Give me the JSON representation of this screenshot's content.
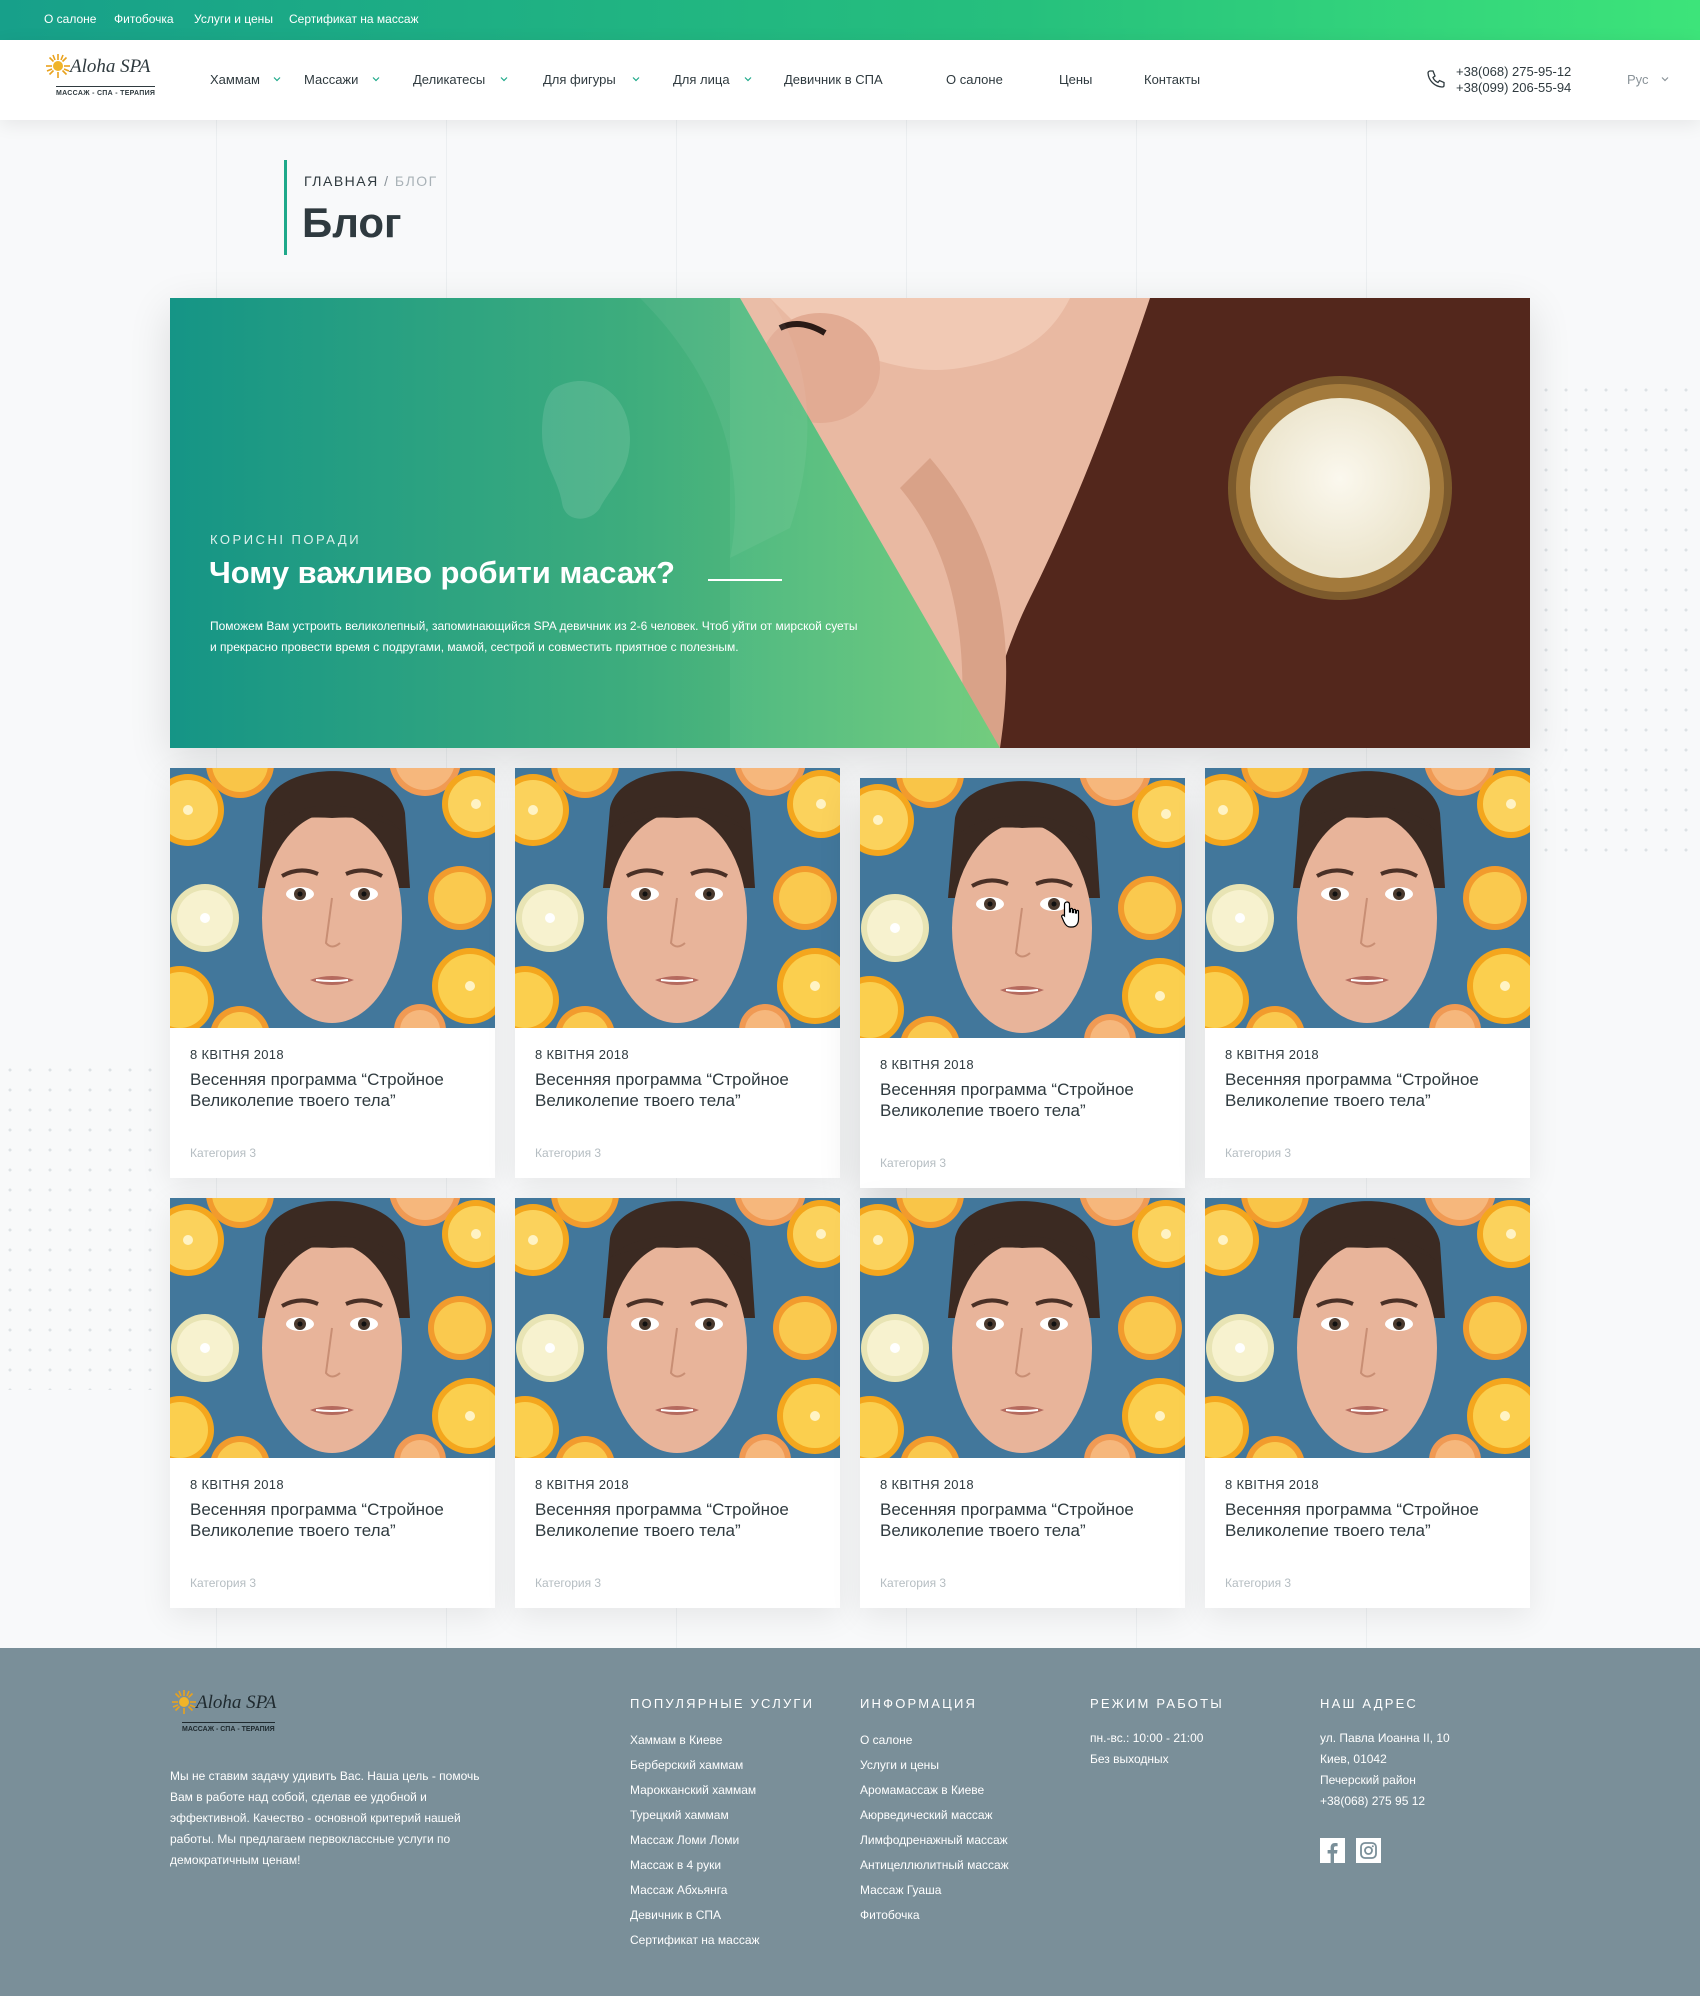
{
  "topbar": {
    "links": [
      "О салоне",
      "Фитобочка",
      "Услуги и цены",
      "Сертификат на массаж"
    ]
  },
  "brand": {
    "name": "Aloha SPA",
    "tagline": "МАССАЖ - СПА - ТЕРАПИЯ"
  },
  "nav": {
    "items": [
      {
        "label": "Хаммам",
        "dropdown": true
      },
      {
        "label": "Массажи",
        "dropdown": true
      },
      {
        "label": "Деликатесы",
        "dropdown": true
      },
      {
        "label": "Для фигуры",
        "dropdown": true
      },
      {
        "label": "Для лица",
        "dropdown": true
      },
      {
        "label": "Девичник в СПА",
        "dropdown": false
      },
      {
        "label": "О салоне",
        "dropdown": false
      },
      {
        "label": "Цены",
        "dropdown": false
      },
      {
        "label": "Контакты",
        "dropdown": false
      }
    ],
    "phone_1": "+38(068) 275-95-12",
    "phone_2": "+38(099) 206-55-94",
    "language": "Рус"
  },
  "breadcrumb": {
    "home": "ГЛАВНАЯ",
    "separator": " / ",
    "current": "БЛОГ"
  },
  "page": {
    "title": "Блог"
  },
  "hero": {
    "label": "КОРИСНІ ПОРАДИ",
    "title": "Чому важливо робити масаж?",
    "description": "Поможем Вам устроить великолепный, запоминающийся SPA девичник из 2-6 человек. Чтоб уйти от мирской суеты и прекрасно провести время с подругами, мамой, сестрой и совместить приятное с полезным."
  },
  "posts": [
    {
      "date": "8 КВІТНЯ 2018",
      "title": "Весенняя программа “Стройное Великолепие твоего тела”",
      "category": "Категория 3"
    },
    {
      "date": "8 КВІТНЯ 2018",
      "title": "Весенняя программа “Стройное Великолепие твоего тела”",
      "category": "Категория 3"
    },
    {
      "date": "8 КВІТНЯ 2018",
      "title": "Весенняя программа “Стройное Великолепие твоего тела”",
      "category": "Категория 3"
    },
    {
      "date": "8 КВІТНЯ 2018",
      "title": "Весенняя программа “Стройное Великолепие твоего тела”",
      "category": "Категория 3"
    },
    {
      "date": "8 КВІТНЯ 2018",
      "title": "Весенняя программа “Стройное Великолепие твоего тела”",
      "category": "Категория 3"
    },
    {
      "date": "8 КВІТНЯ 2018",
      "title": "Весенняя программа “Стройное Великолепие твоего тела”",
      "category": "Категория 3"
    },
    {
      "date": "8 КВІТНЯ 2018",
      "title": "Весенняя программа “Стройное Великолепие твоего тела”",
      "category": "Категория 3"
    },
    {
      "date": "8 КВІТНЯ 2018",
      "title": "Весенняя программа “Стройное Великолепие твоего тела”",
      "category": "Категория 3"
    }
  ],
  "footer": {
    "about": "Мы не ставим задачу удивить Вас. Наша цель - помочь Вам в работе над собой, сделав ее удобной и эффективной. Качество - основной критерий нашей работы. Мы предлагаем первоклассные услуги по демократичным ценам!",
    "services": {
      "heading": "ПОПУЛЯРНЫЕ УСЛУГИ",
      "items": [
        "Хаммам в Киеве",
        "Берберский хаммам",
        "Марокканский хаммам",
        "Турецкий хаммам",
        "Массаж Ломи Ломи",
        "Массаж в 4 руки",
        "Массаж Абхьянга",
        "Девичник в СПА",
        "Сертификат на массаж"
      ]
    },
    "info": {
      "heading": "ИНФОРМАЦИЯ",
      "items": [
        "О салоне",
        "Услуги и цены",
        "Аромамассаж в Киеве",
        "Аюрведический массаж",
        "Лимфодренажный массаж",
        "Антицеллюлитный массаж",
        "Массаж Гуаша",
        "Фитобочка"
      ]
    },
    "hours": {
      "heading": "РЕЖИМ РАБОТЫ",
      "lines": [
        "пн.-вс.: 10:00 - 21:00",
        "Без выходных"
      ]
    },
    "address": {
      "heading": "НАШ АДРЕС",
      "lines": [
        "ул. Павла Иоанна II, 10",
        "Киев, 01042",
        "Печерский район",
        "+38(068) 275 95 12"
      ]
    }
  },
  "icons": {
    "phone": "phone-icon",
    "chevron": "chevron-down-icon",
    "facebook": "facebook-icon",
    "instagram": "instagram-icon",
    "cursor": "hand-pointer-icon"
  },
  "colors": {
    "accent": "#1fa98a",
    "topbar_start": "#17a08a",
    "topbar_end": "#3de47a",
    "footer_bg": "#7a8f99",
    "text_dark": "#2f3a3f"
  }
}
